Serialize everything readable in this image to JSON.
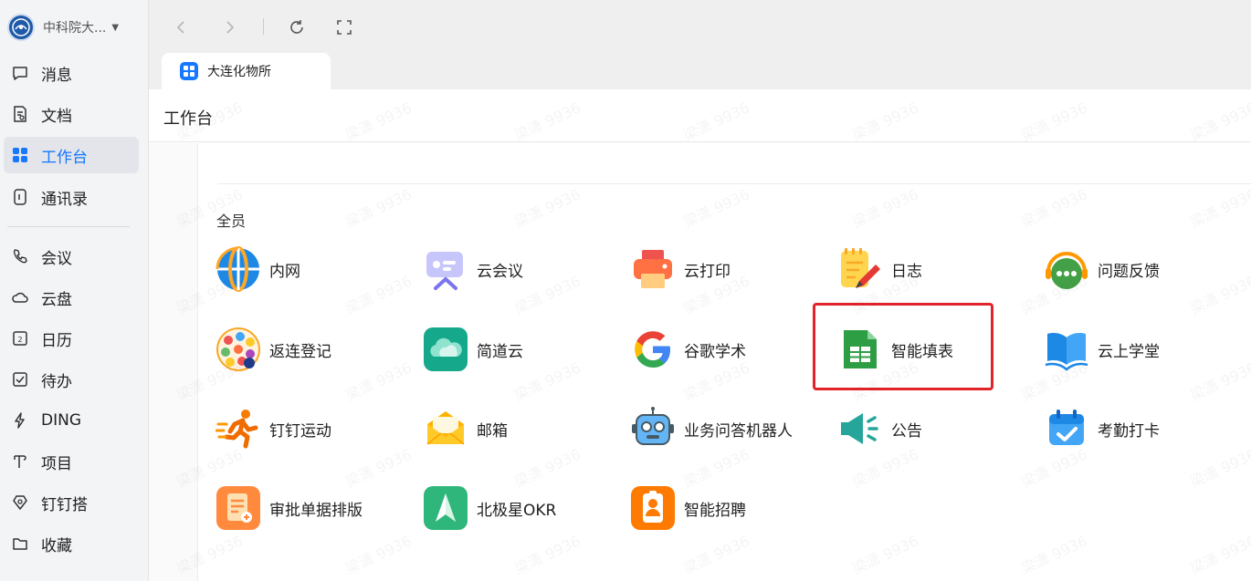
{
  "sidebar": {
    "org_name": "中科院大...",
    "items": [
      {
        "label": "消息",
        "icon": "chat-bubble-icon"
      },
      {
        "label": "文档",
        "icon": "document-icon"
      },
      {
        "label": "工作台",
        "icon": "grid-apps-icon",
        "active": true
      },
      {
        "label": "通讯录",
        "icon": "contacts-icon"
      },
      {
        "label": "会议",
        "icon": "phone-icon"
      },
      {
        "label": "云盘",
        "icon": "cloud-icon"
      },
      {
        "label": "日历",
        "icon": "calendar-icon"
      },
      {
        "label": "待办",
        "icon": "checkbox-icon"
      },
      {
        "label": "DING",
        "icon": "lightning-icon"
      },
      {
        "label": "项目",
        "icon": "project-icon"
      },
      {
        "label": "钉钉搭",
        "icon": "builder-icon"
      },
      {
        "label": "收藏",
        "icon": "folder-icon"
      }
    ]
  },
  "topbar": {
    "tab_label": "大连化物所"
  },
  "page": {
    "title": "工作台",
    "section_title": "全员"
  },
  "apps": [
    {
      "label": "内网",
      "icon": "globe-icon"
    },
    {
      "label": "云会议",
      "icon": "video-meeting-icon"
    },
    {
      "label": "云打印",
      "icon": "printer-icon"
    },
    {
      "label": "日志",
      "icon": "notepad-pen-icon"
    },
    {
      "label": "问题反馈",
      "icon": "feedback-headset-icon"
    },
    {
      "label": "返连登记",
      "icon": "registration-badge-icon"
    },
    {
      "label": "简道云",
      "icon": "cloud-app-icon"
    },
    {
      "label": "谷歌学术",
      "icon": "google-icon"
    },
    {
      "label": "智能填表",
      "icon": "spreadsheet-icon",
      "highlighted": true
    },
    {
      "label": "云上学堂",
      "icon": "open-book-icon"
    },
    {
      "label": "钉钉运动",
      "icon": "running-man-icon"
    },
    {
      "label": "邮箱",
      "icon": "envelope-icon"
    },
    {
      "label": "业务问答机器人",
      "icon": "robot-icon"
    },
    {
      "label": "公告",
      "icon": "megaphone-icon"
    },
    {
      "label": "考勤打卡",
      "icon": "calendar-check-icon"
    },
    {
      "label": "审批单据排版",
      "icon": "approval-doc-icon"
    },
    {
      "label": "北极星OKR",
      "icon": "polaris-arrow-icon"
    },
    {
      "label": "智能招聘",
      "icon": "recruit-badge-icon"
    }
  ],
  "watermark": "梁潇 9936",
  "colors": {
    "accent": "#1677ff",
    "highlight": "#e3232a",
    "sidebar_bg": "#f3f4f6",
    "topbar_bg": "#efefef"
  }
}
